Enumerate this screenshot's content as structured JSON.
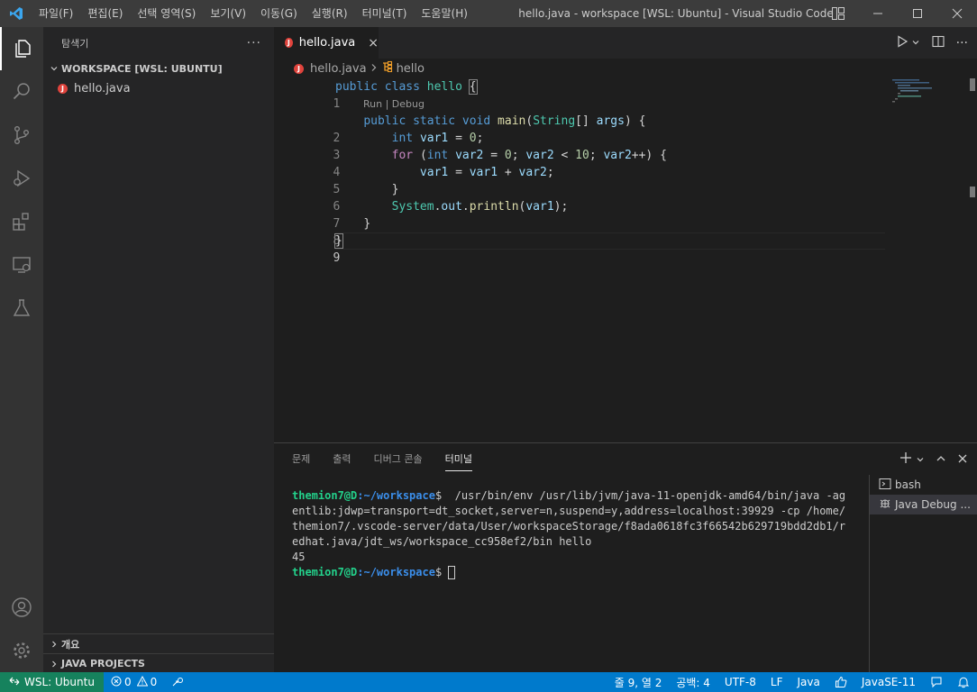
{
  "titlebar": {
    "menu": [
      "파일(F)",
      "편집(E)",
      "선택 영역(S)",
      "보기(V)",
      "이동(G)",
      "실행(R)",
      "터미널(T)",
      "도움말(H)"
    ],
    "title": "hello.java - workspace [WSL: Ubuntu] - Visual Studio Code"
  },
  "sidebar": {
    "title": "탐색기",
    "more": "···",
    "workspace": "WORKSPACE [WSL: UBUNTU]",
    "files": [
      {
        "name": "hello.java",
        "badge": "J"
      }
    ],
    "outline": "개요",
    "java_projects": "JAVA PROJECTS"
  },
  "editor": {
    "tab": "hello.java",
    "tab_close": "×",
    "breadcrumb": [
      "hello.java",
      "hello"
    ],
    "codelens": "Run | Debug",
    "line_numbers": [
      "1",
      "2",
      "3",
      "4",
      "5",
      "6",
      "7",
      "8",
      "9"
    ],
    "lines": [
      "public class hello {",
      "    public static void main(String[] args) {",
      "        int var1 = 0;",
      "        for (int var2 = 0; var2 < 10; var2++) {",
      "            var1 = var1 + var2;",
      "        }",
      "        System.out.println(var1);",
      "    }",
      "}"
    ]
  },
  "panel": {
    "tabs": [
      "문제",
      "출력",
      "디버그 콘솔",
      "터미널"
    ],
    "active_tab": "터미널",
    "prompt_user": "themion7@D",
    "prompt_path": ":~/workspace",
    "prompt_symbol": "$",
    "command": "  /usr/bin/env /usr/lib/jvm/java-11-openjdk-amd64/bin/java -agentlib:jdwp=transport=dt_socket,server=n,suspend=y,address=localhost:39929 -cp /home/themion7/.vscode-server/data/User/workspaceStorage/f8ada0618fc3f66542b629719bdd2db1/redhat.java/jdt_ws/workspace_cc958ef2/bin hello",
    "output": "45",
    "terminals": [
      "bash",
      "Java Debug ..."
    ]
  },
  "statusbar": {
    "remote": "WSL: Ubuntu",
    "errors": "0",
    "warnings": "0",
    "position": "줄 9, 열 2",
    "spaces": "공백: 4",
    "encoding": "UTF-8",
    "eol": "LF",
    "language": "Java",
    "jdk": "JavaSE-11"
  },
  "colors": {
    "accent": "#007acc",
    "remote": "#16825d",
    "java_badge": "#e0433c"
  }
}
